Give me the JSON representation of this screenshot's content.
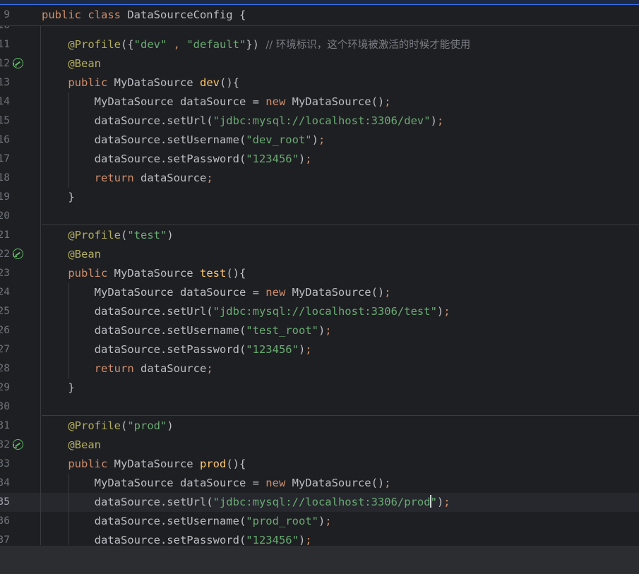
{
  "editor": {
    "sticky_line": {
      "num": "9",
      "tokens": [
        [
          "kw",
          "public class "
        ],
        [
          "plain",
          "DataSourceConfig {"
        ]
      ]
    },
    "lines": [
      {
        "num": "10",
        "tokens": []
      },
      {
        "num": "11",
        "tokens": [
          [
            "ann",
            "    @Profile"
          ],
          [
            "plain",
            "({"
          ],
          [
            "str",
            "\"dev\""
          ],
          [
            "kw",
            " , "
          ],
          [
            "str",
            "\"default\""
          ],
          [
            "plain",
            "}) "
          ],
          [
            "cm",
            "// 环境标识，这个环境被激活的时候才能使用"
          ]
        ]
      },
      {
        "num": "12",
        "icon": "bean-navigation-icon",
        "tokens": [
          [
            "ann",
            "    @Bean"
          ]
        ]
      },
      {
        "num": "13",
        "tokens": [
          [
            "kw",
            "    public "
          ],
          [
            "plain",
            "MyDataSource "
          ],
          [
            "fnd",
            "dev"
          ],
          [
            "plain",
            "(){"
          ]
        ]
      },
      {
        "num": "14",
        "tokens": [
          [
            "plain",
            "        MyDataSource dataSource = "
          ],
          [
            "kw",
            "new "
          ],
          [
            "plain",
            "MyDataSource()"
          ],
          [
            "kw",
            ";"
          ]
        ]
      },
      {
        "num": "15",
        "tokens": [
          [
            "plain",
            "        dataSource.setUrl("
          ],
          [
            "str",
            "\"jdbc:mysql://localhost:3306/dev\""
          ],
          [
            "plain",
            ")"
          ],
          [
            "kw",
            ";"
          ]
        ]
      },
      {
        "num": "16",
        "tokens": [
          [
            "plain",
            "        dataSource.setUsername("
          ],
          [
            "str",
            "\"dev_root\""
          ],
          [
            "plain",
            ")"
          ],
          [
            "kw",
            ";"
          ]
        ]
      },
      {
        "num": "17",
        "tokens": [
          [
            "plain",
            "        dataSource.setPassword("
          ],
          [
            "str",
            "\"123456\""
          ],
          [
            "plain",
            ")"
          ],
          [
            "kw",
            ";"
          ]
        ]
      },
      {
        "num": "18",
        "tokens": [
          [
            "kw",
            "        return "
          ],
          [
            "plain",
            "dataSource"
          ],
          [
            "kw",
            ";"
          ]
        ]
      },
      {
        "num": "19",
        "tokens": [
          [
            "plain",
            "    }"
          ]
        ]
      },
      {
        "num": "20",
        "tokens": []
      },
      {
        "num": "21",
        "tokens": [
          [
            "ann",
            "    @Profile"
          ],
          [
            "plain",
            "("
          ],
          [
            "str",
            "\"test\""
          ],
          [
            "plain",
            ")"
          ]
        ]
      },
      {
        "num": "22",
        "icon": "bean-navigation-icon",
        "tokens": [
          [
            "ann",
            "    @Bean"
          ]
        ]
      },
      {
        "num": "23",
        "tokens": [
          [
            "kw",
            "    public "
          ],
          [
            "plain",
            "MyDataSource "
          ],
          [
            "fnd",
            "test"
          ],
          [
            "plain",
            "(){"
          ]
        ]
      },
      {
        "num": "24",
        "tokens": [
          [
            "plain",
            "        MyDataSource dataSource = "
          ],
          [
            "kw",
            "new "
          ],
          [
            "plain",
            "MyDataSource()"
          ],
          [
            "kw",
            ";"
          ]
        ]
      },
      {
        "num": "25",
        "tokens": [
          [
            "plain",
            "        dataSource.setUrl("
          ],
          [
            "str",
            "\"jdbc:mysql://localhost:3306/test\""
          ],
          [
            "plain",
            ")"
          ],
          [
            "kw",
            ";"
          ]
        ]
      },
      {
        "num": "26",
        "tokens": [
          [
            "plain",
            "        dataSource.setUsername("
          ],
          [
            "str",
            "\"test_root\""
          ],
          [
            "plain",
            ")"
          ],
          [
            "kw",
            ";"
          ]
        ]
      },
      {
        "num": "27",
        "tokens": [
          [
            "plain",
            "        dataSource.setPassword("
          ],
          [
            "str",
            "\"123456\""
          ],
          [
            "plain",
            ")"
          ],
          [
            "kw",
            ";"
          ]
        ]
      },
      {
        "num": "28",
        "tokens": [
          [
            "kw",
            "        return "
          ],
          [
            "plain",
            "dataSource"
          ],
          [
            "kw",
            ";"
          ]
        ]
      },
      {
        "num": "29",
        "tokens": [
          [
            "plain",
            "    }"
          ]
        ]
      },
      {
        "num": "30",
        "tokens": []
      },
      {
        "num": "31",
        "tokens": [
          [
            "ann",
            "    @Profile"
          ],
          [
            "plain",
            "("
          ],
          [
            "str",
            "\"prod\""
          ],
          [
            "plain",
            ")"
          ]
        ]
      },
      {
        "num": "32",
        "icon": "bean-navigation-icon",
        "tokens": [
          [
            "ann",
            "    @Bean"
          ]
        ]
      },
      {
        "num": "33",
        "tokens": [
          [
            "kw",
            "    public "
          ],
          [
            "plain",
            "MyDataSource "
          ],
          [
            "fnd",
            "prod"
          ],
          [
            "plain",
            "(){"
          ]
        ]
      },
      {
        "num": "34",
        "tokens": [
          [
            "plain",
            "        MyDataSource dataSource = "
          ],
          [
            "kw",
            "new "
          ],
          [
            "plain",
            "MyDataSource()"
          ],
          [
            "kw",
            ";"
          ]
        ]
      },
      {
        "num": "35",
        "current": true,
        "tokens": [
          [
            "plain",
            "        dataSource.setUrl("
          ],
          [
            "str",
            "\"jdbc:mysql://localhost:3306/prod"
          ],
          [
            "caret",
            ""
          ],
          [
            "str",
            "\""
          ],
          [
            "plain",
            ")"
          ],
          [
            "kw",
            ";"
          ]
        ]
      },
      {
        "num": "36",
        "tokens": [
          [
            "plain",
            "        dataSource.setUsername("
          ],
          [
            "str",
            "\"prod_root\""
          ],
          [
            "plain",
            ")"
          ],
          [
            "kw",
            ";"
          ]
        ]
      },
      {
        "num": "37",
        "tokens": [
          [
            "plain",
            "        dataSource.setPassword("
          ],
          [
            "str",
            "\"123456\""
          ],
          [
            "plain",
            ")"
          ],
          [
            "kw",
            ";"
          ]
        ]
      }
    ]
  },
  "colors": {
    "background": "#1e1f22",
    "keyword": "#cf8e6d",
    "string": "#6aab73",
    "annotation": "#b3ae60",
    "method_declaration": "#ffc66d",
    "comment": "#7a7e85",
    "gutter_icon": "#5fb865"
  }
}
